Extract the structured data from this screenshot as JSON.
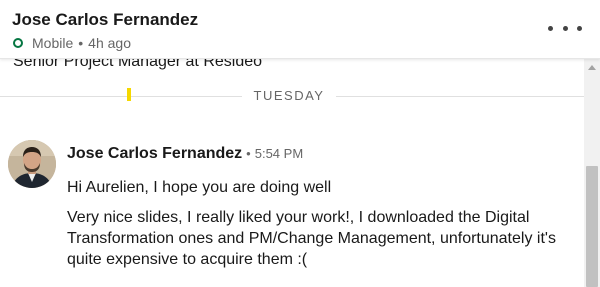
{
  "header": {
    "name": "Jose Carlos Fernandez",
    "status": "Mobile",
    "status_sep": "•",
    "last_seen": "4h ago",
    "status_color": "#057642"
  },
  "conversation": {
    "prev_headline": "Senior Project Manager at Resideo",
    "day_divider": "TUESDAY",
    "message": {
      "sender": "Jose Carlos Fernandez",
      "sep": "•",
      "time": "5:54 PM",
      "paragraphs": [
        "Hi Aurelien, I hope you are doing well",
        "Very nice slides, I really liked your work!, I downloaded the Digital Transformation ones and PM/Change Management, unfortunately it's quite expensive to acquire them  :("
      ]
    }
  },
  "icons": {
    "more": "more-options-icon",
    "status": "online-status-icon",
    "scroll_up": "scroll-up-arrow-icon"
  }
}
